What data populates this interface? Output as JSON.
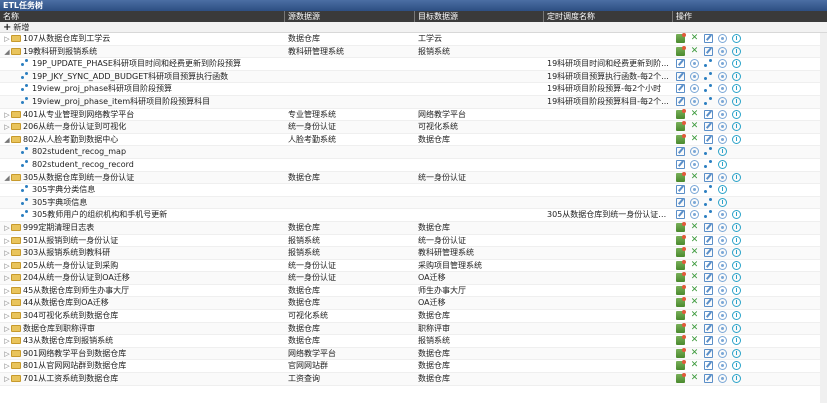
{
  "panel": {
    "title": "ETL任务树"
  },
  "columns": {
    "name": "名称",
    "source": "源数据源",
    "target": "目标数据源",
    "schedule": "定时调度名称",
    "actions": "操作"
  },
  "toolbar": {
    "add_label": "新增"
  },
  "colors": {
    "titlebar": "#2d4f82",
    "header": "#3a3a3a",
    "folder": "#e9c45c"
  },
  "rows": [
    {
      "name": "107从数据仓库到工学云",
      "source": "数据仓库",
      "target": "工学云",
      "schedule": ""
    },
    {
      "name": "19教科研到报销系统",
      "source": "教科研管理系统",
      "target": "报销系统",
      "schedule": ""
    },
    {
      "name": "19P_UPDATE_PHASE科研项目时间和经费更新到阶段预算",
      "source": "",
      "target": "",
      "schedule": "19科研项目时间和经费更新到阶..."
    },
    {
      "name": "19P_JKY_SYNC_ADD_BUDGET科研项目预算执行函数",
      "source": "",
      "target": "",
      "schedule": "19科研项目预算执行函数-每2个..."
    },
    {
      "name": "19view_proj_phase科研项目阶段预算",
      "source": "",
      "target": "",
      "schedule": "19科研项目阶段预算-每2个小时"
    },
    {
      "name": "19view_proj_phase_item科研项目阶段预算科目",
      "source": "",
      "target": "",
      "schedule": "19科研项目阶段预算科目-每2个..."
    },
    {
      "name": "401从专业管理到网络教学平台",
      "source": "专业管理系统",
      "target": "网络教学平台",
      "schedule": ""
    },
    {
      "name": "206从统一身份认证到可视化",
      "source": "统一身份认证",
      "target": "可视化系统",
      "schedule": ""
    },
    {
      "name": "802从人脸考勤到数据中心",
      "source": "人脸考勤系统",
      "target": "数据仓库",
      "schedule": ""
    },
    {
      "name": "802student_recog_map",
      "source": "",
      "target": "",
      "schedule": ""
    },
    {
      "name": "802student_recog_record",
      "source": "",
      "target": "",
      "schedule": ""
    },
    {
      "name": "305从数据仓库到统一身份认证",
      "source": "数据仓库",
      "target": "统一身份认证",
      "schedule": ""
    },
    {
      "name": "305字典分类信息",
      "source": "",
      "target": "",
      "schedule": ""
    },
    {
      "name": "305字典项信息",
      "source": "",
      "target": "",
      "schedule": ""
    },
    {
      "name": "305教师用户的组织机构和手机号更新",
      "source": "",
      "target": "",
      "schedule": "305从数据仓库到统一身份认证教..."
    },
    {
      "name": "999定期清理日志表",
      "source": "数据仓库",
      "target": "数据仓库",
      "schedule": ""
    },
    {
      "name": "501从报销到统一身份认证",
      "source": "报销系统",
      "target": "统一身份认证",
      "schedule": ""
    },
    {
      "name": "303从报销系统到教科研",
      "source": "报销系统",
      "target": "教科研管理系统",
      "schedule": ""
    },
    {
      "name": "205从统一身份认证到采购",
      "source": "统一身份认证",
      "target": "采购项目管理系统",
      "schedule": ""
    },
    {
      "name": "204从统一身份认证到OA迁移",
      "source": "统一身份认证",
      "target": "OA迁移",
      "schedule": ""
    },
    {
      "name": "45从数据仓库到师生办事大厅",
      "source": "数据仓库",
      "target": "师生办事大厅",
      "schedule": ""
    },
    {
      "name": "44从数据仓库到OA迁移",
      "source": "数据仓库",
      "target": "OA迁移",
      "schedule": ""
    },
    {
      "name": "304可视化系统到数据仓库",
      "source": "可视化系统",
      "target": "数据仓库",
      "schedule": ""
    },
    {
      "name": "数据仓库到职称评审",
      "source": "数据仓库",
      "target": "职称评审",
      "schedule": ""
    },
    {
      "name": "43从数据仓库到报销系统",
      "source": "数据仓库",
      "target": "报销系统",
      "schedule": ""
    },
    {
      "name": "901网络教学平台到数据仓库",
      "source": "网络教学平台",
      "target": "数据仓库",
      "schedule": ""
    },
    {
      "name": "801从官网网站群到数据仓库",
      "source": "官网网站群",
      "target": "数据仓库",
      "schedule": ""
    },
    {
      "name": "701从工资系统到数据仓库",
      "source": "工资查询",
      "target": "数据仓库",
      "schedule": ""
    }
  ]
}
